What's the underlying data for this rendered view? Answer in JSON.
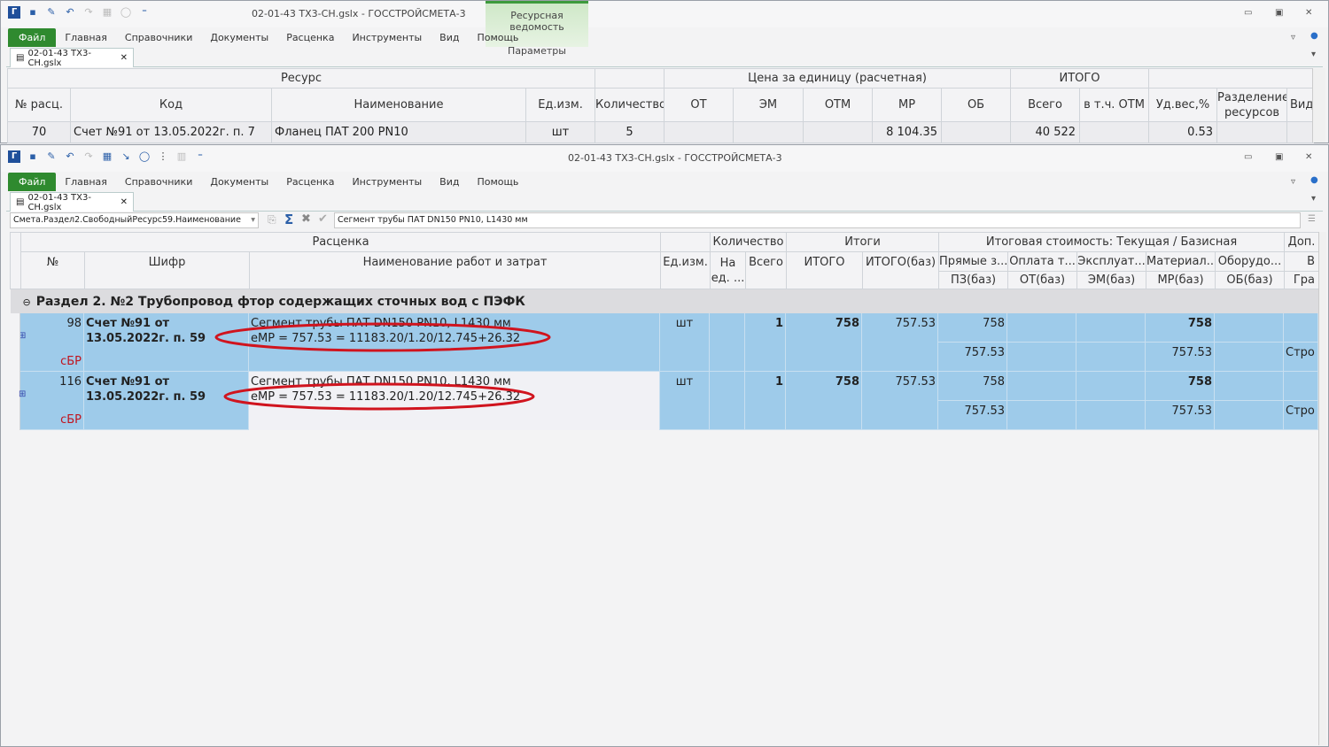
{
  "app": {
    "title": "02-01-43 ТХ3-СН.gslx - ГОССТРОЙСМЕТА-3",
    "file_tab": "Файл",
    "ribbon_tabs": [
      "Главная",
      "Справочники",
      "Документы",
      "Расценка",
      "Инструменты",
      "Вид",
      "Помощь"
    ],
    "doc_tab": "02-01-43 ТХ3-СН.gslx",
    "context_group": "Ресурсная ведомость",
    "context_tab": "Параметры"
  },
  "win1": {
    "group_headers": {
      "resource": "Ресурс",
      "price": "Цена за единицу (расчетная)",
      "total": "ИТОГО"
    },
    "columns": [
      "№ расц.",
      "Код",
      "Наименование",
      "Ед.изм.",
      "Количество",
      "ОТ",
      "ЭМ",
      "ОТМ",
      "МР",
      "ОБ",
      "Всего",
      "в т.ч. ОТМ",
      "Уд.вес,%",
      "Разделение ресурсов",
      "Вид"
    ],
    "row": {
      "num": "70",
      "code": "Счет №91 от 13.05.2022г. п. 7",
      "name": "Фланец ПАТ 200 PN10",
      "unit": "шт",
      "qty": "5",
      "ot": "",
      "em": "",
      "otm": "",
      "mr": "8 104.35",
      "ob": "",
      "total": "40 522",
      "total_otm": "",
      "weight": "0.53"
    }
  },
  "win2": {
    "field_path": "Смета.Раздел2.СвободныйРесурс59.Наименование",
    "field_value": "Сегмент трубы ПАТ DN150 PN10, L1430 мм",
    "group_headers": {
      "rate": "Расценка",
      "qty": "Количество",
      "totals": "Итоги",
      "cost": "Итоговая стоимость: Текущая / Базисная",
      "extra": "Доп."
    },
    "columns": {
      "num": "№",
      "code": "Шифр",
      "name": "Наименование работ и затрат",
      "unit": "Ед.изм.",
      "per_unit": "На ед. ...",
      "qty_total": "Всего",
      "itogo": "ИТОГО",
      "itogo_base": "ИТОГО(баз)",
      "pz": "Прямые з...",
      "ot": "Оплата т...",
      "em": "Эксплуат...",
      "mr": "Материал...",
      "ob": "Оборудо...",
      "extra": "В",
      "pz_b": "ПЗ(баз)",
      "ot_b": "ОТ(баз)",
      "em_b": "ЭМ(баз)",
      "mr_b": "МР(баз)",
      "ob_b": "ОБ(баз)",
      "extra_b": "Гра"
    },
    "section": "Раздел 2. №2 Трубопровод фтор содержащих сточных вод с ПЭФК",
    "rows": [
      {
        "num": "98",
        "code1": "Счет №91 от",
        "code2": "13.05.2022г. п. 59",
        "tag": "сБР",
        "name1": "Сегмент трубы ПАТ DN150 PN10, L1430 мм",
        "name2": "еМР = 757.53 = 11183.20/1.20/12.745+26.32",
        "unit": "шт",
        "qty": "1",
        "itogo": "758",
        "itogo_base": "757.53",
        "pz": "758",
        "mr": "758",
        "pz_b": "757.53",
        "mr_b": "757.53",
        "extra_b": "Строи"
      },
      {
        "num": "116",
        "code1": "Счет №91 от",
        "code2": "13.05.2022г. п. 59",
        "tag": "сБР",
        "name1": "Сегмент трубы ПАТ DN150 PN10, L1430 мм",
        "name2": "еМР = 757.53 = 11183.20/1.20/12.745+26.32",
        "unit": "шт",
        "qty": "1",
        "itogo": "758",
        "itogo_base": "757.53",
        "pz": "758",
        "mr": "758",
        "pz_b": "757.53",
        "mr_b": "757.53",
        "extra_b": "Строи"
      }
    ]
  },
  "colors": {
    "selection": "#9ecbea",
    "file_tab": "#2f8a2f",
    "annotation": "#d0141e"
  }
}
